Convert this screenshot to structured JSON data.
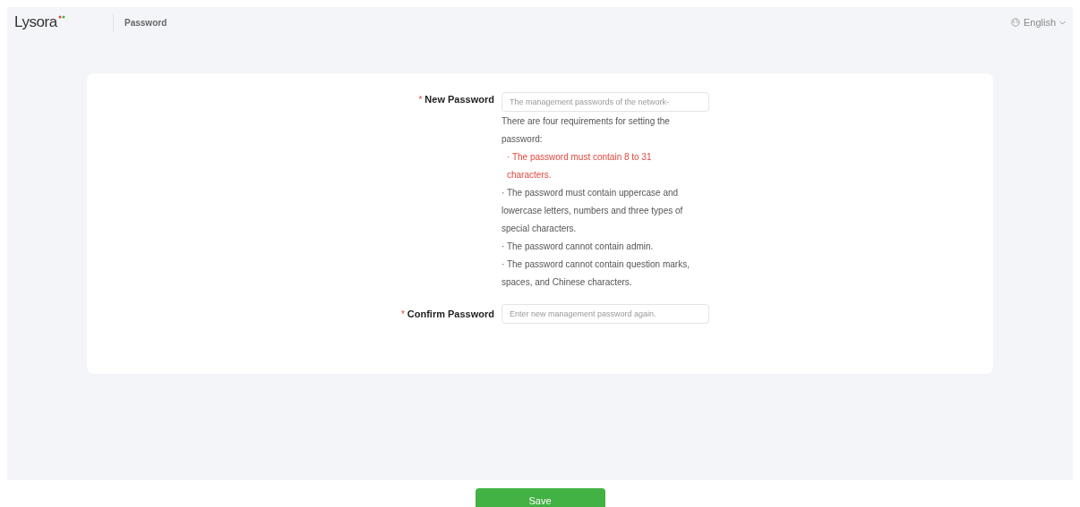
{
  "header": {
    "logo": "Lysora",
    "title": "Password",
    "language": "English"
  },
  "form": {
    "new_password": {
      "label": "New Password",
      "required_mark": "*",
      "placeholder": "The management passwords of the network-"
    },
    "hint": "There are four requirements for setting the password:",
    "requirements": [
      {
        "text": "· The password must contain 8 to 31 characters.",
        "failed": true
      },
      {
        "text": "· The password must contain uppercase and lowercase letters, numbers and three types of special characters.",
        "failed": false
      },
      {
        "text": "· The password cannot contain admin.",
        "failed": false
      },
      {
        "text": "· The password cannot contain question marks, spaces, and Chinese characters.",
        "failed": false
      }
    ],
    "confirm_password": {
      "label": "Confirm Password",
      "required_mark": "*",
      "placeholder": "Enter new management password again."
    }
  },
  "save_button": "Save"
}
